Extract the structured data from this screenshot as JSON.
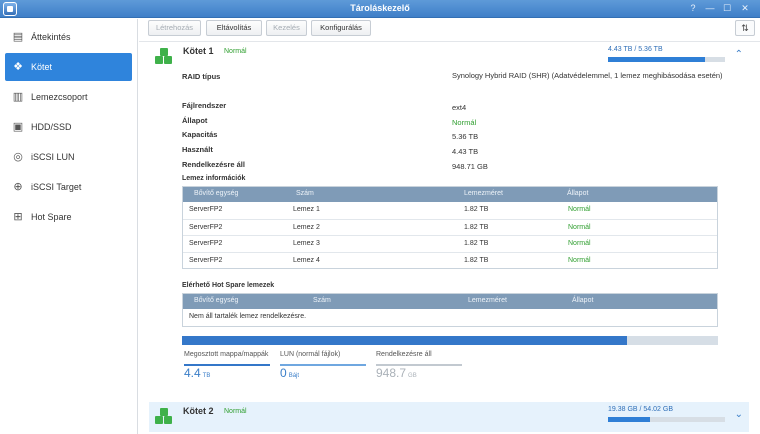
{
  "window": {
    "title": "Tároláskezelő",
    "controls": [
      "?",
      "—",
      "☐",
      "✕"
    ]
  },
  "sidebar": {
    "items": [
      {
        "label": "Áttekintés",
        "icon": "overview-icon"
      },
      {
        "label": "Kötet",
        "icon": "volume-icon",
        "active": true
      },
      {
        "label": "Lemezcsoport",
        "icon": "disk-group-icon"
      },
      {
        "label": "HDD/SSD",
        "icon": "hdd-icon"
      },
      {
        "label": "iSCSI LUN",
        "icon": "lun-icon"
      },
      {
        "label": "iSCSI Target",
        "icon": "target-icon"
      },
      {
        "label": "Hot Spare",
        "icon": "hot-spare-icon"
      }
    ]
  },
  "toolbar": {
    "create": "Létrehozás",
    "remove": "Eltávolítás",
    "manage": "Kezelés",
    "configure": "Konfigurálás"
  },
  "volume1": {
    "name": "Kötet 1",
    "status": "Normál",
    "usage_text": "4.43 TB / 5.36 TB",
    "usage_fraction": 0.83,
    "props": [
      {
        "label": "RAID típus",
        "value": "Synology Hybrid RAID (SHR) (Adatvédelemmel, 1 lemez meghibásodása esetén)"
      },
      {
        "label": "Fájlrendszer",
        "value": "ext4"
      },
      {
        "label": "Állapot",
        "value": "Normál"
      },
      {
        "label": "Kapacitás",
        "value": "5.36 TB"
      },
      {
        "label": "Használt",
        "value": "4.43 TB"
      },
      {
        "label": "Rendelkezésre áll",
        "value": "948.71 GB"
      }
    ],
    "disk_info": {
      "title": "Lemez információk",
      "columns": [
        "Bővítő egység",
        "Szám",
        "Lemezméret",
        "Állapot"
      ],
      "rows": [
        [
          "ServerFP2",
          "Lemez 1",
          "1.82 TB",
          "Normál"
        ],
        [
          "ServerFP2",
          "Lemez 2",
          "1.82 TB",
          "Normál"
        ],
        [
          "ServerFP2",
          "Lemez 3",
          "1.82 TB",
          "Normál"
        ],
        [
          "ServerFP2",
          "Lemez 4",
          "1.82 TB",
          "Normál"
        ]
      ]
    },
    "hot_spare": {
      "title": "Elérhető Hot Spare lemezek",
      "columns": [
        "Bővítő egység",
        "Szám",
        "Lemezméret",
        "Állapot"
      ],
      "empty": "Nem áll tartalék lemez rendelkezésre."
    },
    "allocation_fraction": 0.83,
    "legend": [
      {
        "label": "Megosztott mappa/mappák",
        "value": "4.4",
        "unit": "TB",
        "color": "#3477c9"
      },
      {
        "label": "LUN (normál fájlok)",
        "value": "0",
        "unit": "Bájt",
        "color": "#6fa7e0"
      },
      {
        "label": "Rendelkezésre áll",
        "value": "948.7",
        "unit": "GB",
        "color": "#c2c9d0"
      }
    ]
  },
  "volume2": {
    "name": "Kötet 2",
    "status": "Normál",
    "usage_text": "19.38 GB / 54.02 GB",
    "usage_fraction": 0.36
  }
}
